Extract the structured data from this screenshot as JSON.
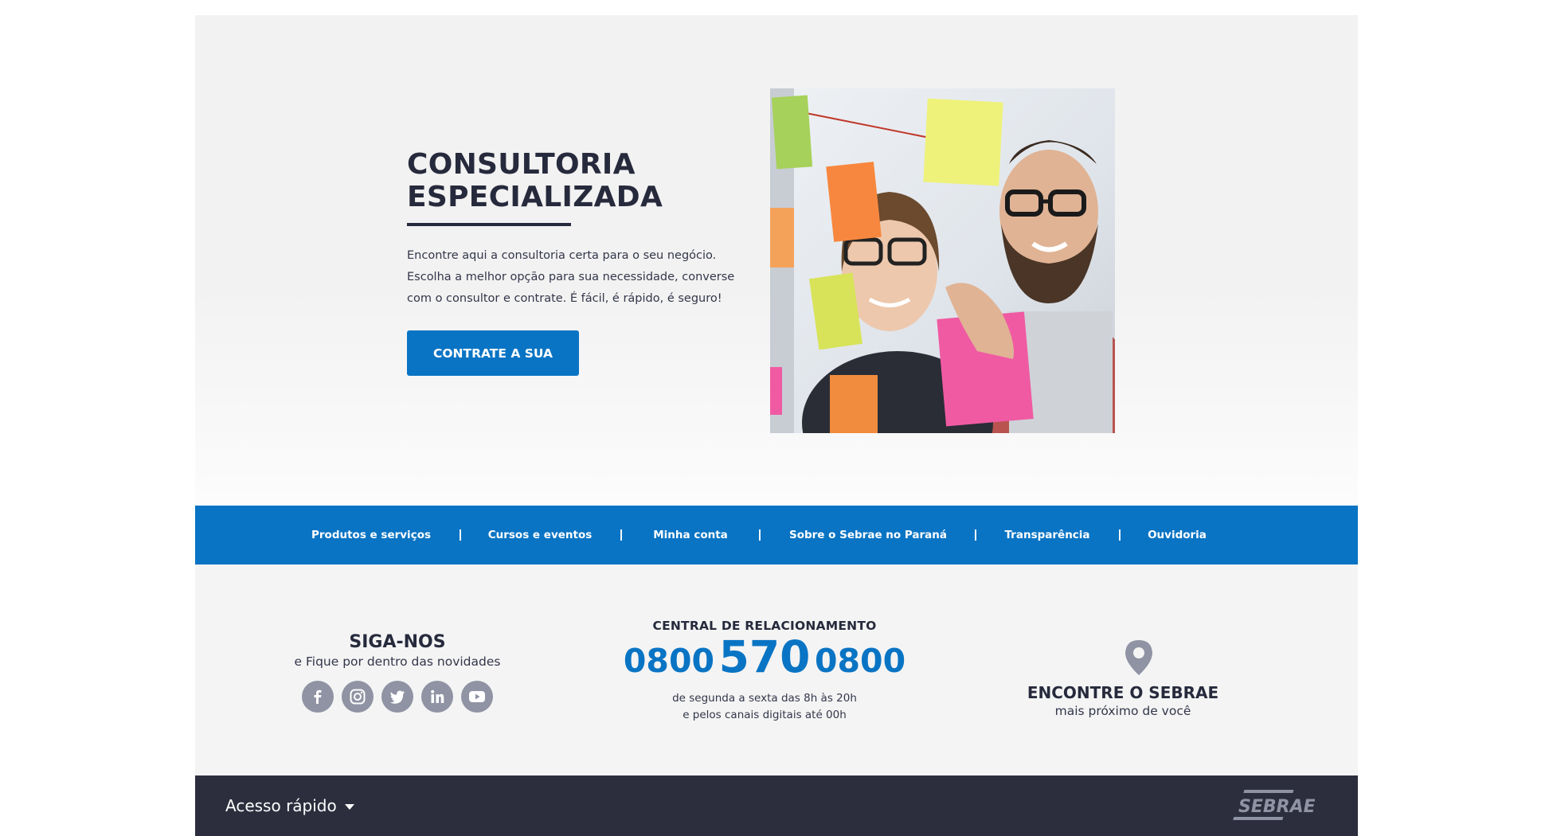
{
  "hero": {
    "title_line1": "CONSULTORIA",
    "title_line2": "ESPECIALIZADA",
    "text_line1": "Encontre aqui a consultoria certa para o seu negócio.",
    "text_line2": "Escolha a melhor opção para sua necessidade, converse",
    "text_line3": "com o consultor e contrate. É fácil, é rápido, é seguro!",
    "button_label": "CONTRATE A SUA"
  },
  "nav": {
    "items": [
      {
        "label": "Produtos e serviços"
      },
      {
        "label": "Cursos e eventos"
      },
      {
        "label": "Minha conta"
      },
      {
        "label": "Sobre o Sebrae no Paraná"
      },
      {
        "label": "Transparência"
      },
      {
        "label": "Ouvidoria"
      }
    ],
    "separator": "|"
  },
  "follow": {
    "heading": "SIGA-NOS",
    "subheading": "e Fique por dentro das novidades",
    "socials": [
      "facebook-icon",
      "instagram-icon",
      "twitter-icon",
      "linkedin-icon",
      "youtube-icon"
    ]
  },
  "central": {
    "heading": "CENTRAL DE RELACIONAMENTO",
    "phone_part1": "0800",
    "phone_part2": "570",
    "phone_part3": "0800",
    "hours_line1": "de segunda a sexta das 8h às 20h",
    "hours_line2": "e pelos canais digitais até 00h"
  },
  "find": {
    "icon": "location-pin-icon",
    "heading": "ENCONTRE O SEBRAE",
    "subheading": "mais próximo de você"
  },
  "footer": {
    "quick_access_label": "Acesso rápido",
    "logo_text": "SEBRAE"
  },
  "colors": {
    "brand_blue": "#0a74c4",
    "dark_navy": "#262a3c",
    "footer_bg": "#2c2e3d",
    "icon_gray": "#8f93a3"
  }
}
